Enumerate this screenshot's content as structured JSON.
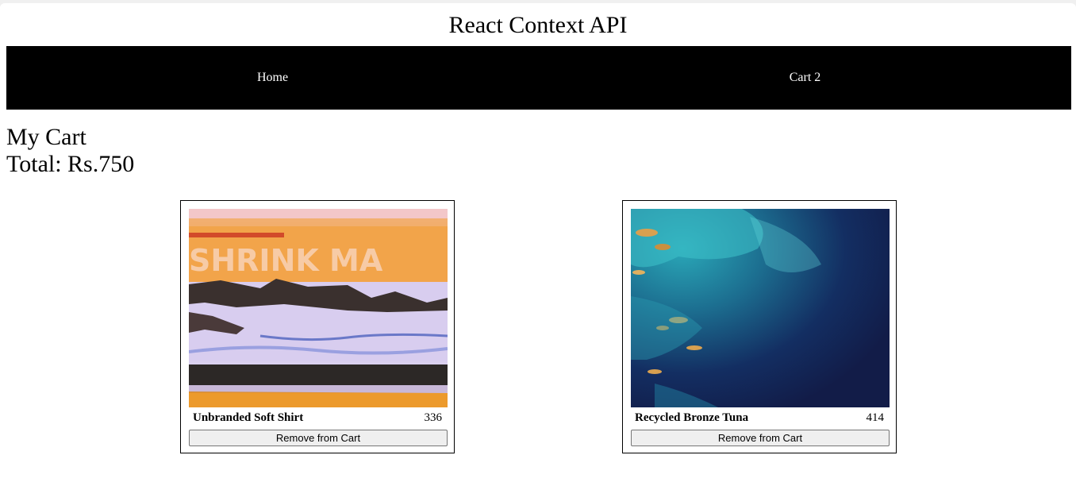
{
  "header": {
    "title": "React Context API"
  },
  "nav": {
    "home_label": "Home",
    "cart_label": "Cart 2"
  },
  "cart": {
    "heading": "My Cart",
    "total_text": "Total: Rs.750",
    "items": [
      {
        "name": "Unbranded Soft Shirt",
        "price": "336",
        "remove_label": "Remove from Cart",
        "image_alt": "product-photo"
      },
      {
        "name": "Recycled Bronze Tuna",
        "price": "414",
        "remove_label": "Remove from Cart",
        "image_alt": "product-photo"
      }
    ]
  },
  "colors": {
    "nav_background": "#000000",
    "page_background": "#ffffff"
  }
}
